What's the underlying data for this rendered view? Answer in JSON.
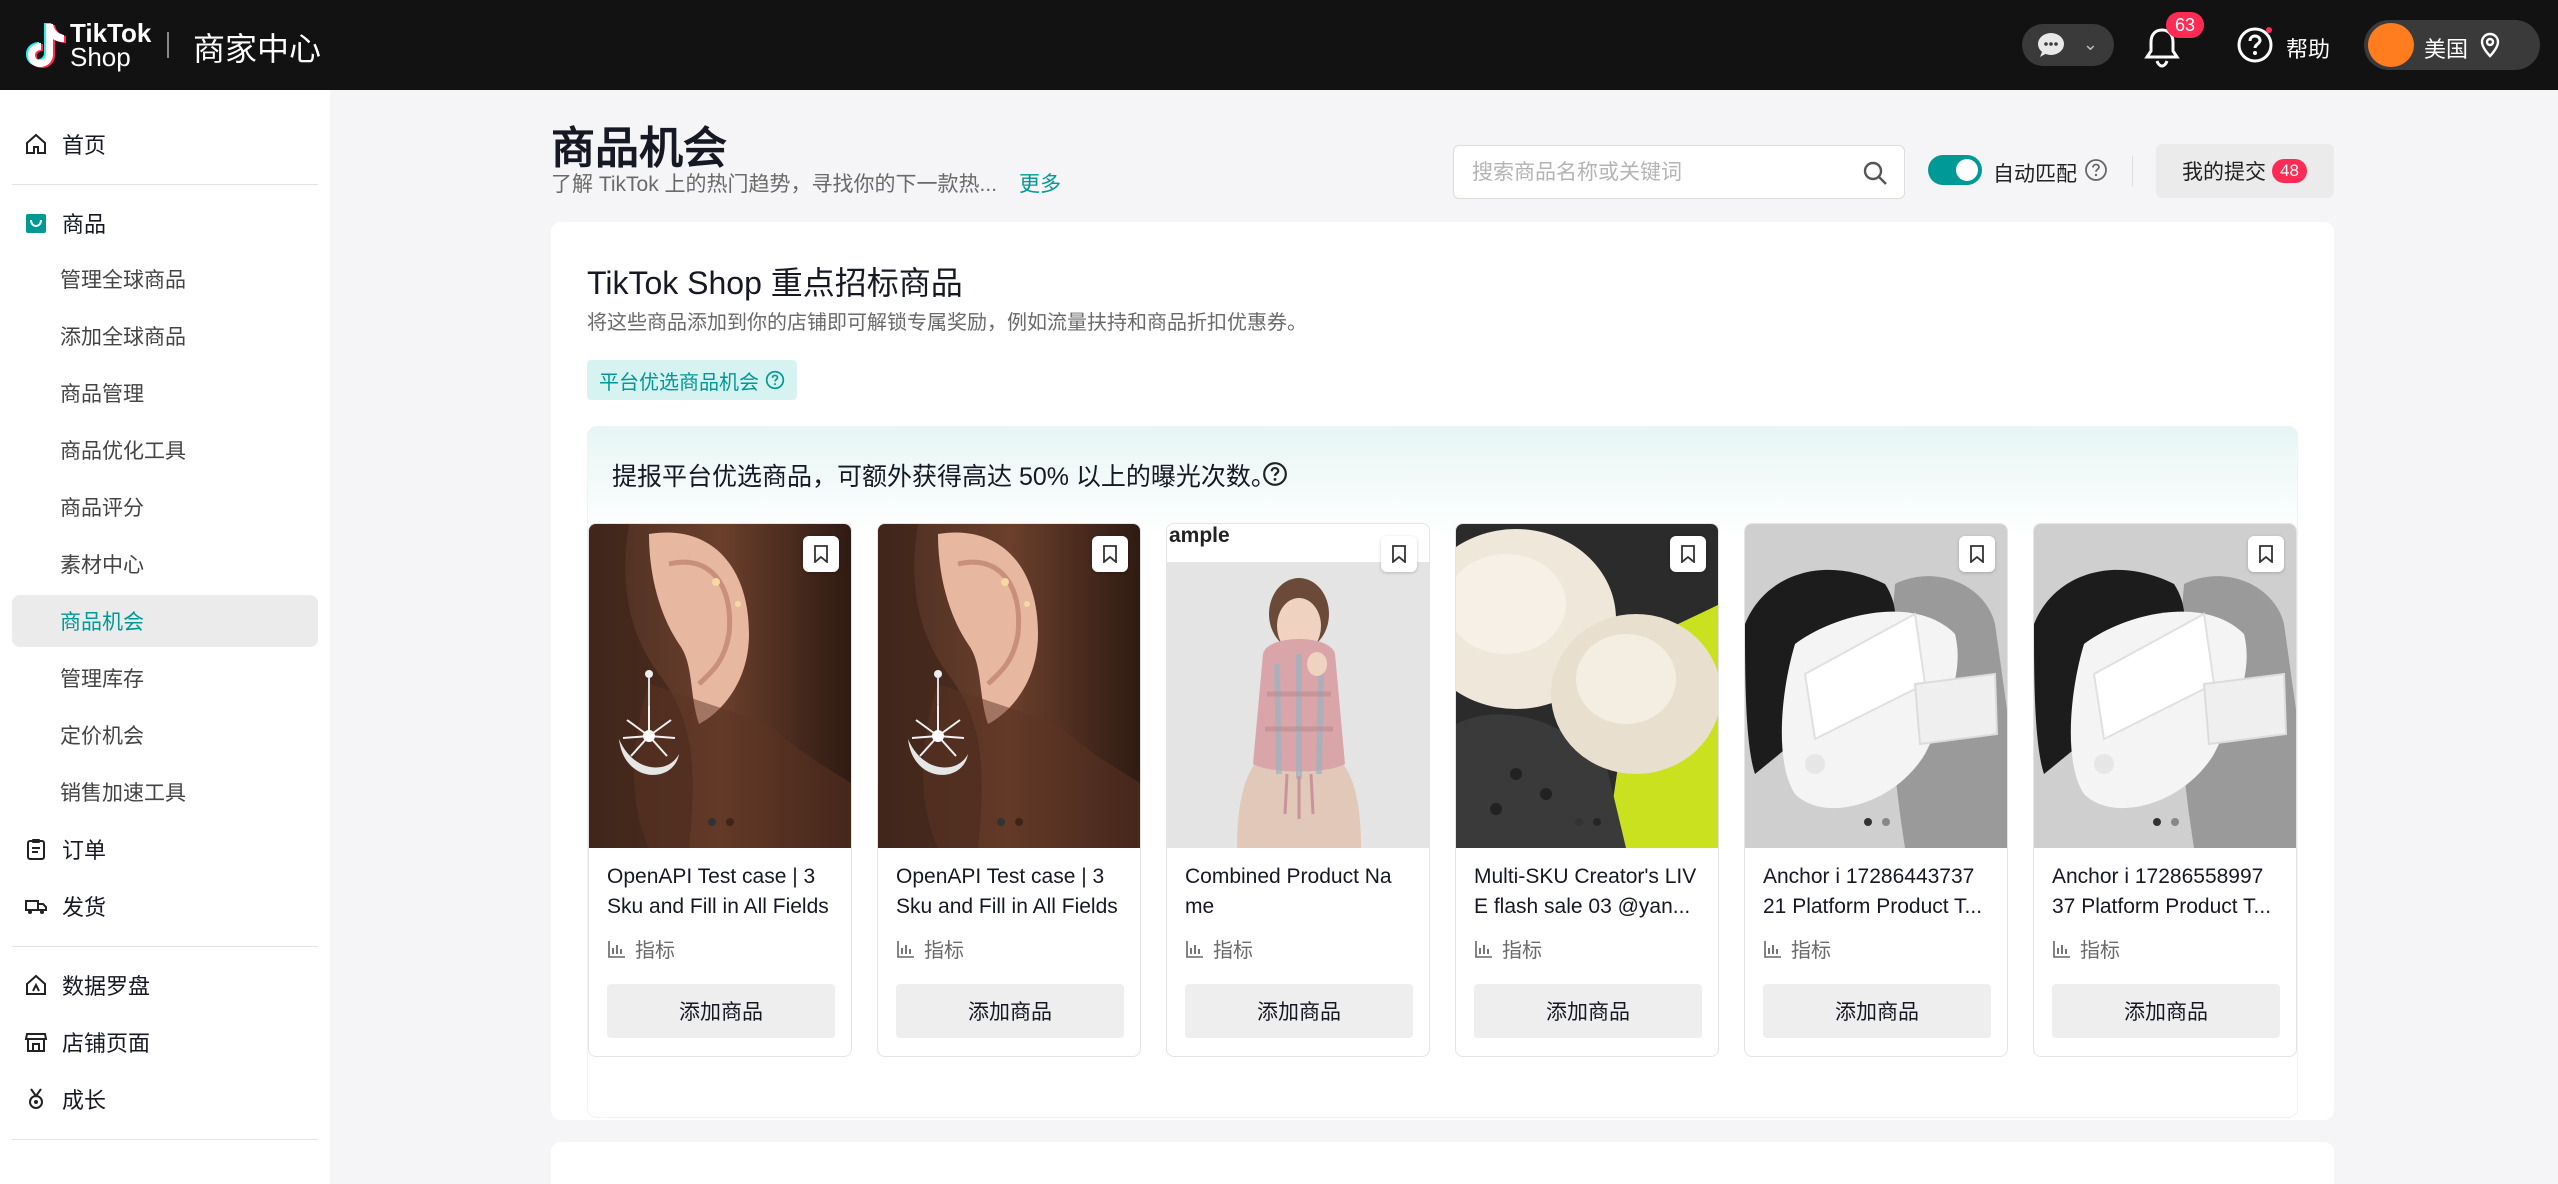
{
  "header": {
    "logo_line1": "TikTok",
    "logo_line2": "Shop",
    "brand_title": "商家中心",
    "notification_count": "63",
    "help_label": "帮助",
    "region_label": "美国"
  },
  "sidebar": {
    "home": "首页",
    "products": "商品",
    "product_subitems": [
      "管理全球商品",
      "添加全球商品",
      "商品管理",
      "商品优化工具",
      "商品评分",
      "素材中心",
      "商品机会",
      "管理库存",
      "定价机会",
      "销售加速工具"
    ],
    "active_item": "商品机会",
    "orders": "订单",
    "shipping": "发货",
    "data_compass": "数据罗盘",
    "shop_page": "店铺页面",
    "growth": "成长"
  },
  "page": {
    "title": "商品机会",
    "subtitle": "了解 TikTok 上的热门趋势，寻找你的下一款热...",
    "more_link": "更多",
    "search_placeholder": "搜索商品名称或关键词",
    "auto_match_label": "自动匹配",
    "auto_match_on": true,
    "my_submissions_label": "我的提交",
    "my_submissions_count": "48"
  },
  "panel": {
    "title": "TikTok Shop 重点招标商品",
    "subtitle": "将这些商品添加到你的店铺即可解锁专属奖励，例如流量扶持和商品折扣优惠券。",
    "tag_label": "平台优选商品机会",
    "promo_text": "提报平台优选商品，可额外获得高达 50% 以上的曝光次数。",
    "metric_label": "指标",
    "add_button_label": "添加商品",
    "cards": [
      {
        "name": "OpenAPI Test case | 3 Sku and Fill in All Fields",
        "image": "earring"
      },
      {
        "name": "OpenAPI Test case | 3 Sku and Fill in All Fields",
        "image": "earring"
      },
      {
        "name": "Combined Product Na me",
        "image": "scarf",
        "image_caption": "ample"
      },
      {
        "name": "Multi-SKU Creator's LIV E flash sale 03 @yan...",
        "image": "fur-clog"
      },
      {
        "name": "Anchor i 17286443737 21 Platform Product T...",
        "image": "socks"
      },
      {
        "name": "Anchor i 17286558997 37 Platform Product T...",
        "image": "socks"
      }
    ]
  },
  "colors": {
    "accent": "#009995",
    "badge": "#fe2c55",
    "topbar": "#121212",
    "active_bg": "#ebebeb"
  }
}
